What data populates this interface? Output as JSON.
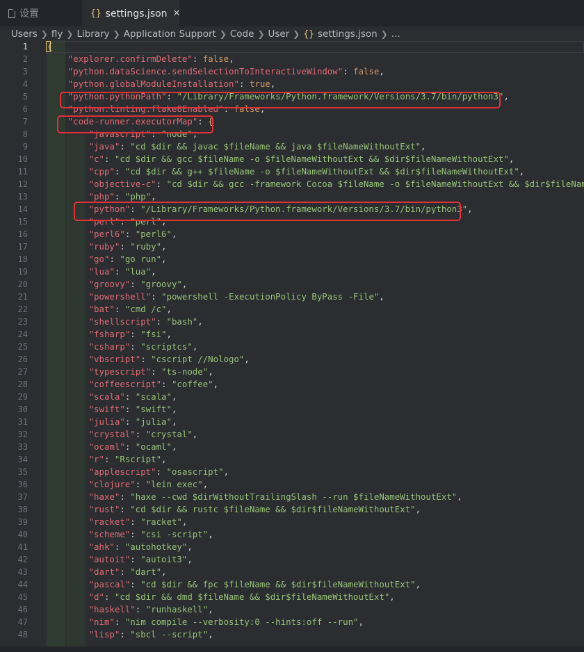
{
  "tabs": [
    {
      "label": "设置",
      "icon": "file-icon",
      "active": false
    },
    {
      "label": "settings.json",
      "icon": "json-braces-icon",
      "active": true
    }
  ],
  "breadcrumb": [
    "Users",
    "fly",
    "Library",
    "Application Support",
    "Code",
    "User",
    "settings.json",
    "..."
  ],
  "editor": {
    "current_line": 1,
    "lines": [
      {
        "n": "1",
        "indent": 0,
        "key": "",
        "value": "",
        "raw": "{"
      },
      {
        "n": "2",
        "indent": 1,
        "key": "\"explorer.confirmDelete\"",
        "value": "false",
        "type": "bool",
        "comma": true
      },
      {
        "n": "3",
        "indent": 1,
        "key": "\"python.dataScience.sendSelectionToInteractiveWindow\"",
        "value": "false",
        "type": "bool",
        "comma": true
      },
      {
        "n": "4",
        "indent": 1,
        "key": "\"python.globalModuleInstallation\"",
        "value": "true",
        "type": "bool",
        "comma": true
      },
      {
        "n": "5",
        "indent": 1,
        "key": "\"python.pythonPath\"",
        "value": "\"/Library/Frameworks/Python.framework/Versions/3.7/bin/python3\"",
        "type": "str",
        "comma": true
      },
      {
        "n": "6",
        "indent": 1,
        "key": "\"python.linting.flake8Enabled\"",
        "value": "false",
        "type": "bool",
        "comma": true
      },
      {
        "n": "7",
        "indent": 1,
        "key": "\"code-runner.executorMap\"",
        "value": "{",
        "type": "open",
        "comma": false
      },
      {
        "n": "8",
        "indent": 2,
        "key": "\"javascript\"",
        "value": "\"node\"",
        "type": "str",
        "comma": true
      },
      {
        "n": "9",
        "indent": 2,
        "key": "\"java\"",
        "value": "\"cd $dir && javac $fileName && java $fileNameWithoutExt\"",
        "type": "str",
        "comma": true
      },
      {
        "n": "10",
        "indent": 2,
        "key": "\"c\"",
        "value": "\"cd $dir && gcc $fileName -o $fileNameWithoutExt && $dir$fileNameWithoutExt\"",
        "type": "str",
        "comma": true
      },
      {
        "n": "11",
        "indent": 2,
        "key": "\"cpp\"",
        "value": "\"cd $dir && g++ $fileName -o $fileNameWithoutExt && $dir$fileNameWithoutExt\"",
        "type": "str",
        "comma": true
      },
      {
        "n": "12",
        "indent": 2,
        "key": "\"objective-c\"",
        "value": "\"cd $dir && gcc -framework Cocoa $fileName -o $fileNameWithoutExt && $dir$fileNameWi",
        "type": "str",
        "comma": false
      },
      {
        "n": "13",
        "indent": 2,
        "key": "\"php\"",
        "value": "\"php\"",
        "type": "str",
        "comma": true
      },
      {
        "n": "14",
        "indent": 2,
        "key": "\"python\"",
        "value": "\"/Library/Frameworks/Python.framework/Versions/3.7/bin/python3\"",
        "type": "str",
        "comma": true
      },
      {
        "n": "15",
        "indent": 2,
        "key": "\"perl\"",
        "value": "\"perl\"",
        "type": "str",
        "comma": true
      },
      {
        "n": "16",
        "indent": 2,
        "key": "\"perl6\"",
        "value": "\"perl6\"",
        "type": "str",
        "comma": true
      },
      {
        "n": "17",
        "indent": 2,
        "key": "\"ruby\"",
        "value": "\"ruby\"",
        "type": "str",
        "comma": true
      },
      {
        "n": "18",
        "indent": 2,
        "key": "\"go\"",
        "value": "\"go run\"",
        "type": "str",
        "comma": true
      },
      {
        "n": "19",
        "indent": 2,
        "key": "\"lua\"",
        "value": "\"lua\"",
        "type": "str",
        "comma": true
      },
      {
        "n": "20",
        "indent": 2,
        "key": "\"groovy\"",
        "value": "\"groovy\"",
        "type": "str",
        "comma": true
      },
      {
        "n": "21",
        "indent": 2,
        "key": "\"powershell\"",
        "value": "\"powershell -ExecutionPolicy ByPass -File\"",
        "type": "str",
        "comma": true
      },
      {
        "n": "22",
        "indent": 2,
        "key": "\"bat\"",
        "value": "\"cmd /c\"",
        "type": "str",
        "comma": true
      },
      {
        "n": "23",
        "indent": 2,
        "key": "\"shellscript\"",
        "value": "\"bash\"",
        "type": "str",
        "comma": true
      },
      {
        "n": "24",
        "indent": 2,
        "key": "\"fsharp\"",
        "value": "\"fsi\"",
        "type": "str",
        "comma": true
      },
      {
        "n": "25",
        "indent": 2,
        "key": "\"csharp\"",
        "value": "\"scriptcs\"",
        "type": "str",
        "comma": true
      },
      {
        "n": "26",
        "indent": 2,
        "key": "\"vbscript\"",
        "value": "\"cscript //Nologo\"",
        "type": "str",
        "comma": true
      },
      {
        "n": "27",
        "indent": 2,
        "key": "\"typescript\"",
        "value": "\"ts-node\"",
        "type": "str",
        "comma": true
      },
      {
        "n": "28",
        "indent": 2,
        "key": "\"coffeescript\"",
        "value": "\"coffee\"",
        "type": "str",
        "comma": true
      },
      {
        "n": "29",
        "indent": 2,
        "key": "\"scala\"",
        "value": "\"scala\"",
        "type": "str",
        "comma": true
      },
      {
        "n": "30",
        "indent": 2,
        "key": "\"swift\"",
        "value": "\"swift\"",
        "type": "str",
        "comma": true
      },
      {
        "n": "31",
        "indent": 2,
        "key": "\"julia\"",
        "value": "\"julia\"",
        "type": "str",
        "comma": true
      },
      {
        "n": "32",
        "indent": 2,
        "key": "\"crystal\"",
        "value": "\"crystal\"",
        "type": "str",
        "comma": true
      },
      {
        "n": "33",
        "indent": 2,
        "key": "\"ocaml\"",
        "value": "\"ocaml\"",
        "type": "str",
        "comma": true
      },
      {
        "n": "34",
        "indent": 2,
        "key": "\"r\"",
        "value": "\"Rscript\"",
        "type": "str",
        "comma": true
      },
      {
        "n": "35",
        "indent": 2,
        "key": "\"applescript\"",
        "value": "\"osascript\"",
        "type": "str",
        "comma": true
      },
      {
        "n": "36",
        "indent": 2,
        "key": "\"clojure\"",
        "value": "\"lein exec\"",
        "type": "str",
        "comma": true
      },
      {
        "n": "37",
        "indent": 2,
        "key": "\"haxe\"",
        "value": "\"haxe --cwd $dirWithoutTrailingSlash --run $fileNameWithoutExt\"",
        "type": "str",
        "comma": true
      },
      {
        "n": "38",
        "indent": 2,
        "key": "\"rust\"",
        "value": "\"cd $dir && rustc $fileName && $dir$fileNameWithoutExt\"",
        "type": "str",
        "comma": true
      },
      {
        "n": "39",
        "indent": 2,
        "key": "\"racket\"",
        "value": "\"racket\"",
        "type": "str",
        "comma": true
      },
      {
        "n": "40",
        "indent": 2,
        "key": "\"scheme\"",
        "value": "\"csi -script\"",
        "type": "str",
        "comma": true
      },
      {
        "n": "41",
        "indent": 2,
        "key": "\"ahk\"",
        "value": "\"autohotkey\"",
        "type": "str",
        "comma": true
      },
      {
        "n": "42",
        "indent": 2,
        "key": "\"autoit\"",
        "value": "\"autoit3\"",
        "type": "str",
        "comma": true
      },
      {
        "n": "43",
        "indent": 2,
        "key": "\"dart\"",
        "value": "\"dart\"",
        "type": "str",
        "comma": true
      },
      {
        "n": "44",
        "indent": 2,
        "key": "\"pascal\"",
        "value": "\"cd $dir && fpc $fileName && $dir$fileNameWithoutExt\"",
        "type": "str",
        "comma": true
      },
      {
        "n": "45",
        "indent": 2,
        "key": "\"d\"",
        "value": "\"cd $dir && dmd $fileName && $dir$fileNameWithoutExt\"",
        "type": "str",
        "comma": true
      },
      {
        "n": "46",
        "indent": 2,
        "key": "\"haskell\"",
        "value": "\"runhaskell\"",
        "type": "str",
        "comma": true
      },
      {
        "n": "47",
        "indent": 2,
        "key": "\"nim\"",
        "value": "\"nim compile --verbosity:0 --hints:off --run\"",
        "type": "str",
        "comma": true
      },
      {
        "n": "48",
        "indent": 2,
        "key": "\"lisp\"",
        "value": "\"sbcl --script\"",
        "type": "str",
        "comma": true
      }
    ]
  },
  "highlighted_lines": [
    "5",
    "7",
    "14"
  ],
  "colors": {
    "highlight_box": "#e0303a",
    "key": "#e06c75",
    "string": "#98c379",
    "boolean": "#d19a66",
    "bracket": "#e5c07b"
  }
}
